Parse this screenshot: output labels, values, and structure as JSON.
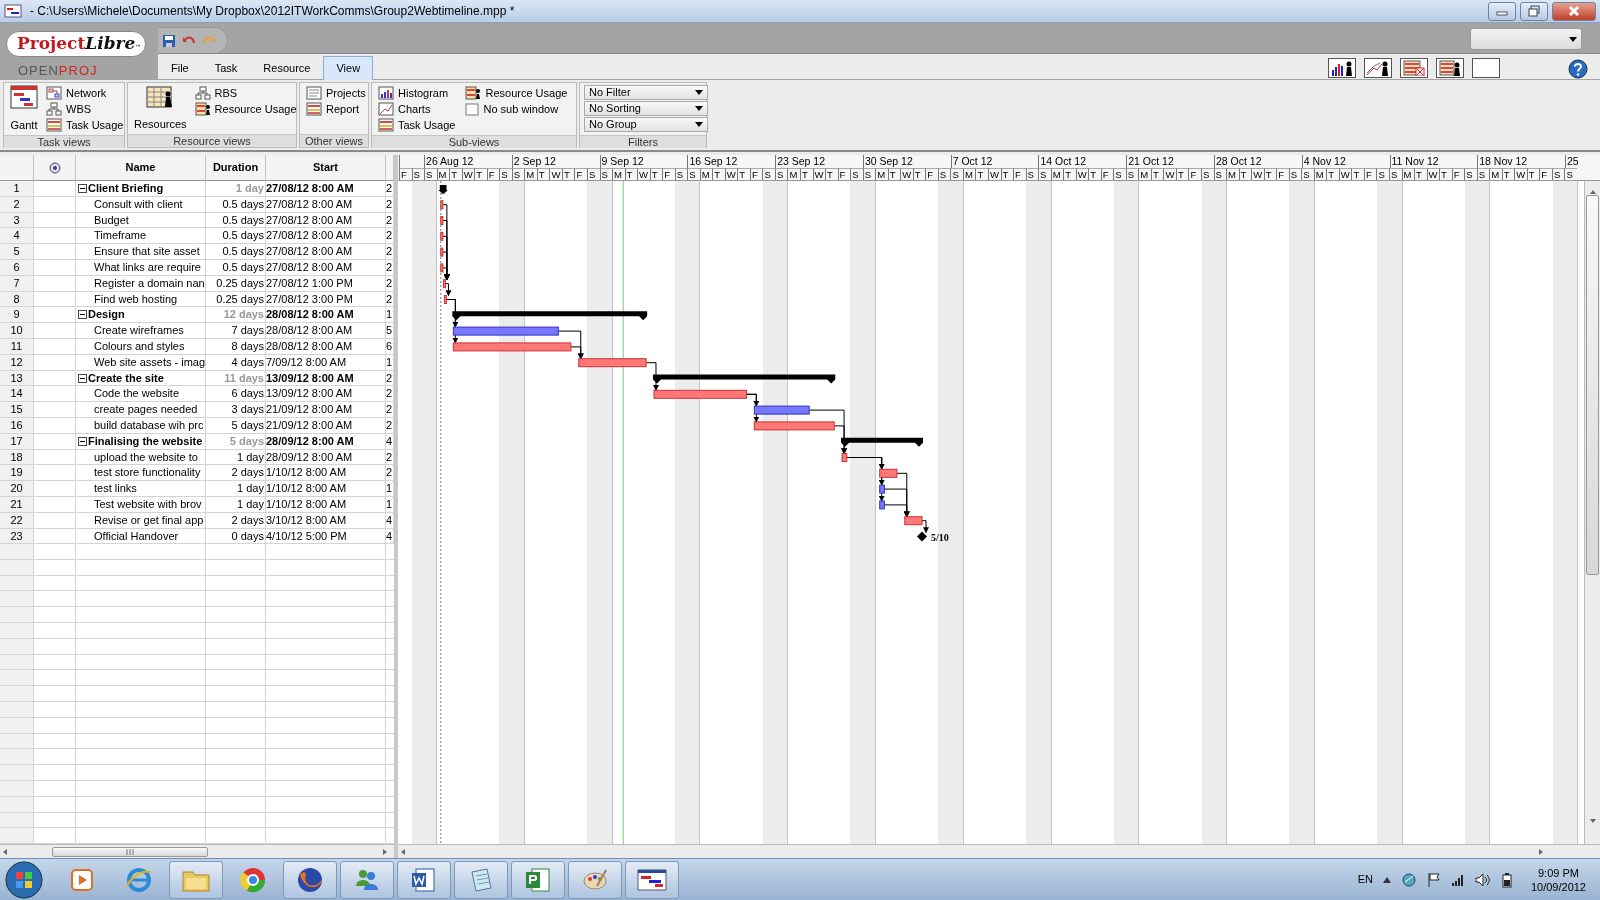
{
  "window": {
    "title": "- C:\\Users\\Michele\\Documents\\My Dropbox\\2012ITWorkComms\\Group2Webtimeline.mpp *"
  },
  "logo": {
    "part_a": "Project",
    "part_b": "Libre",
    "mark": "™",
    "sub_a": "OPEN",
    "sub_b": "PROJ"
  },
  "tabs": [
    {
      "label": "File",
      "selected": false
    },
    {
      "label": "Task",
      "selected": false
    },
    {
      "label": "Resource",
      "selected": false
    },
    {
      "label": "View",
      "selected": true
    }
  ],
  "ribbon": [
    {
      "caption": "Task views",
      "large": "Gantt",
      "items": [
        "Network",
        "WBS",
        "Task Usage"
      ]
    },
    {
      "caption": "Resource views",
      "large": "Resources",
      "items": [
        "RBS",
        "Resource Usage"
      ]
    },
    {
      "caption": "Other views",
      "items": [
        "Projects",
        "Report"
      ]
    },
    {
      "caption": "Sub-views",
      "items": [
        "Histogram",
        "Charts",
        "Task Usage",
        "Resource Usage",
        "No sub window"
      ]
    },
    {
      "caption": "Filters",
      "dropdowns": [
        "No Filter",
        "No Sorting",
        "No Group"
      ]
    }
  ],
  "table": {
    "columns": [
      "Name",
      "Duration",
      "Start"
    ],
    "tasks": [
      {
        "row": "1",
        "name": "Client Briefing",
        "duration": "1 day",
        "start": "27/08/12 8:00 AM",
        "column_5": "2",
        "kind": "summary",
        "expanded": true,
        "children": [
          {
            "row": "2",
            "name": "Consult with client",
            "duration": "0.5 days",
            "start": "27/08/12 8:00 AM",
            "column_5": "2",
            "kind": "task",
            "critical": true
          },
          {
            "row": "3",
            "name": "Budget",
            "duration": "0.5 days",
            "start": "27/08/12 8:00 AM",
            "column_5": "2",
            "kind": "task",
            "critical": true
          },
          {
            "row": "4",
            "name": "Timeframe",
            "duration": "0.5 days",
            "start": "27/08/12 8:00 AM",
            "column_5": "2",
            "kind": "task",
            "critical": true
          },
          {
            "row": "5",
            "name": "Ensure that site asset",
            "duration": "0.5 days",
            "start": "27/08/12 8:00 AM",
            "column_5": "2",
            "kind": "task",
            "critical": true
          },
          {
            "row": "6",
            "name": "What links are require",
            "duration": "0.5 days",
            "start": "27/08/12 8:00 AM",
            "column_5": "2",
            "kind": "task",
            "critical": true
          },
          {
            "row": "7",
            "name": "Register a domain nan",
            "duration": "0.25 days",
            "start": "27/08/12 1:00 PM",
            "column_5": "2",
            "kind": "task",
            "critical": true
          },
          {
            "row": "8",
            "name": "Find web hosting",
            "duration": "0.25 days",
            "start": "27/08/12 3:00 PM",
            "column_5": "2",
            "kind": "task",
            "critical": true
          }
        ]
      },
      {
        "row": "9",
        "name": "Design",
        "duration": "12 days",
        "start": "28/08/12 8:00 AM",
        "column_5": "1",
        "kind": "summary",
        "expanded": true,
        "children": [
          {
            "row": "10",
            "name": "Create wireframes",
            "duration": "7 days",
            "start": "28/08/12 8:00 AM",
            "column_5": "5",
            "kind": "task",
            "critical": false
          },
          {
            "row": "11",
            "name": "Colours and styles",
            "duration": "8 days",
            "start": "28/08/12 8:00 AM",
            "column_5": "6",
            "kind": "task",
            "critical": true
          },
          {
            "row": "12",
            "name": "Web site assets - imag",
            "duration": "4 days",
            "start": "7/09/12 8:00 AM",
            "column_5": "1",
            "kind": "task",
            "critical": true
          }
        ]
      },
      {
        "row": "13",
        "name": "Create the site",
        "duration": "11 days",
        "start": "13/09/12 8:00 AM",
        "column_5": "2",
        "kind": "summary",
        "expanded": true,
        "children": [
          {
            "row": "14",
            "name": "Code the website",
            "duration": "6 days",
            "start": "13/09/12 8:00 AM",
            "column_5": "2",
            "kind": "task",
            "critical": true
          },
          {
            "row": "15",
            "name": "create pages needed",
            "duration": "3 days",
            "start": "21/09/12 8:00 AM",
            "column_5": "2",
            "kind": "task",
            "critical": false
          },
          {
            "row": "16",
            "name": "build database wih prc",
            "duration": "5 days",
            "start": "21/09/12 8:00 AM",
            "column_5": "2",
            "kind": "task",
            "critical": true
          }
        ]
      },
      {
        "row": "17",
        "name": "Finalising the website",
        "duration": "5 days",
        "start": "28/09/12 8:00 AM",
        "column_5": "4",
        "kind": "summary",
        "expanded": true,
        "children": [
          {
            "row": "18",
            "name": "upload the website to",
            "duration": "1 day",
            "start": "28/09/12 8:00 AM",
            "column_5": "2",
            "kind": "task",
            "critical": true
          },
          {
            "row": "19",
            "name": "test store functionality",
            "duration": "2 days",
            "start": "1/10/12 8:00 AM",
            "column_5": "2",
            "kind": "task",
            "critical": true
          },
          {
            "row": "20",
            "name": "test links",
            "duration": "1 day",
            "start": "1/10/12 8:00 AM",
            "column_5": "1",
            "kind": "task",
            "critical": false
          },
          {
            "row": "21",
            "name": "Test website with brov",
            "duration": "1 day",
            "start": "1/10/12 8:00 AM",
            "column_5": "1",
            "kind": "task",
            "critical": false
          },
          {
            "row": "22",
            "name": "Revise or get final app",
            "duration": "2 days",
            "start": "3/10/12 8:00 AM",
            "column_5": "4",
            "kind": "task",
            "critical": true
          },
          {
            "row": "23",
            "name": "Official Handover",
            "duration": "0 days",
            "start": "4/10/12 5:00 PM",
            "column_5": "4",
            "kind": "milestone",
            "label": "5/10"
          }
        ]
      }
    ]
  },
  "timeline": {
    "lead_days": [
      "F",
      "S"
    ],
    "weeks": [
      {
        "label": "26 Aug 12",
        "days": [
          "S",
          "M",
          "T",
          "W",
          "T",
          "F",
          "S"
        ]
      },
      {
        "label": "2 Sep 12",
        "days": [
          "S",
          "M",
          "T",
          "W",
          "T",
          "F",
          "S"
        ]
      },
      {
        "label": "9 Sep 12",
        "days": [
          "S",
          "M",
          "T",
          "W",
          "T",
          "F",
          "S"
        ]
      },
      {
        "label": "16 Sep 12",
        "days": [
          "S",
          "M",
          "T",
          "W",
          "T",
          "F",
          "S"
        ]
      },
      {
        "label": "23 Sep 12",
        "days": [
          "S",
          "M",
          "T",
          "W",
          "T",
          "F",
          "S"
        ]
      },
      {
        "label": "30 Sep 12",
        "days": [
          "S",
          "M",
          "T",
          "W",
          "T",
          "F",
          "S"
        ]
      },
      {
        "label": "7 Oct 12",
        "days": [
          "S",
          "M",
          "T",
          "W",
          "T",
          "F",
          "S"
        ]
      },
      {
        "label": "14 Oct 12",
        "days": [
          "S",
          "M",
          "T",
          "W",
          "T",
          "F",
          "S"
        ]
      },
      {
        "label": "21 Oct 12",
        "days": [
          "S",
          "M",
          "T",
          "W",
          "T",
          "F",
          "S"
        ]
      },
      {
        "label": "28 Oct 12",
        "days": [
          "S",
          "M",
          "T",
          "W",
          "T",
          "F",
          "S"
        ]
      },
      {
        "label": "4 Nov 12",
        "days": [
          "S",
          "M",
          "T",
          "W",
          "T",
          "F",
          "S"
        ]
      },
      {
        "label": "11 Nov 12",
        "days": [
          "S",
          "M",
          "T",
          "W",
          "T",
          "F",
          "S"
        ]
      },
      {
        "label": "18 Nov 12",
        "days": [
          "S",
          "M",
          "T",
          "W",
          "T",
          "F",
          "S"
        ]
      },
      {
        "label": "25",
        "days": [
          "S"
        ]
      }
    ]
  },
  "taskbar": {
    "apps": [
      {
        "running": false
      },
      {
        "running": false
      },
      {
        "running": true
      },
      {
        "running": false
      },
      {
        "running": true
      },
      {
        "running": true
      },
      {
        "running": true
      },
      {
        "running": true
      },
      {
        "running": true
      },
      {
        "running": true
      },
      {
        "running": true
      }
    ],
    "language": "EN",
    "time": "9:09 PM",
    "date": "10/09/2012"
  }
}
